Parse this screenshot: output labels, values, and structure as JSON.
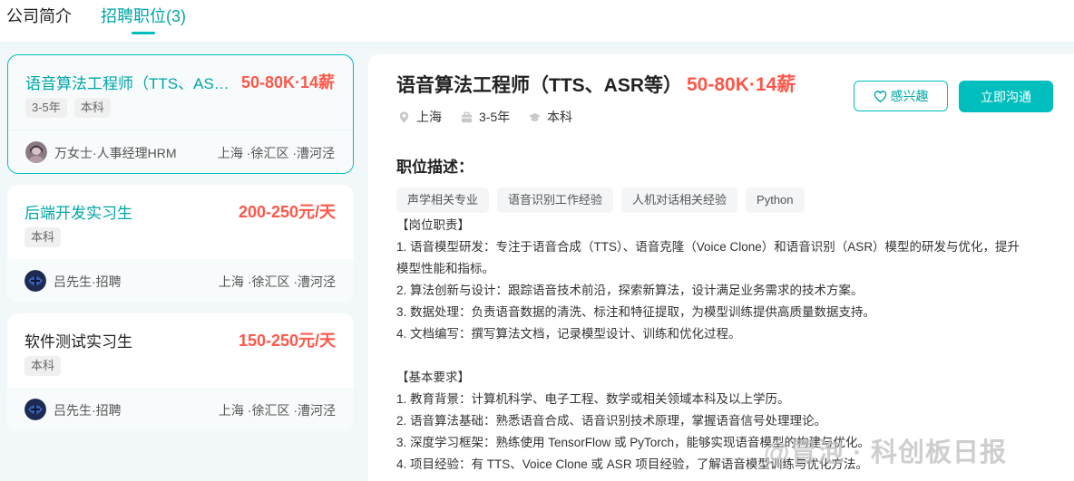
{
  "tabs": [
    {
      "label": "公司简介"
    },
    {
      "label": "招聘职位(3)"
    }
  ],
  "jobs": [
    {
      "title": "语音算法工程师（TTS、ASR等）",
      "salary": "50-80K·14薪",
      "tags": [
        "3-5年",
        "本科"
      ],
      "recruiter": "万女士·人事经理HRM",
      "location": "上海 ·徐汇区 ·漕河泾"
    },
    {
      "title": "后端开发实习生",
      "salary": "200-250元/天",
      "tags": [
        "本科"
      ],
      "recruiter": "吕先生·招聘",
      "location": "上海 ·徐汇区 ·漕河泾"
    },
    {
      "title": "软件测试实习生",
      "salary": "150-250元/天",
      "tags": [
        "本科"
      ],
      "recruiter": "吕先生·招聘",
      "location": "上海 ·徐汇区 ·漕河泾"
    }
  ],
  "detail": {
    "title": "语音算法工程师（TTS、ASR等）",
    "salary": "50-80K·14薪",
    "city": "上海",
    "experience": "3-5年",
    "degree": "本科",
    "interest_label": "感兴趣",
    "chat_label": "立即沟通",
    "section_title": "职位描述：",
    "skills": [
      "声学相关专业",
      "语音识别工作经验",
      "人机对话相关经验",
      "Python"
    ],
    "lines": [
      "【岗位职责】",
      "1. 语音模型研发：专注于语音合成（TTS）、语音克隆（Voice Clone）和语音识别（ASR）模型的研发与优化，提升",
      "模型性能和指标。",
      "2. 算法创新与设计：跟踪语音技术前沿，探索新算法，设计满足业务需求的技术方案。",
      "3. 数据处理：负责语音数据的清洗、标注和特征提取，为模型训练提供高质量数据支持。",
      "4. 文档编写：撰写算法文档，记录模型设计、训练和优化过程。",
      "",
      "【基本要求】",
      "1. 教育背景：计算机科学、电子工程、数学或相关领域本科及以上学历。",
      "2. 语音算法基础：熟悉语音合成、语音识别技术原理，掌握语音信号处理理论。",
      "3. 深度学习框架：熟练使用 TensorFlow 或 PyTorch，能够实现语音模型的构建与优化。",
      "4. 项目经验：有 TTS、Voice Clone 或 ASR 项目经验，了解语音模型训练与优化方法。"
    ]
  },
  "watermark": "@冒泡 · 科创板日报",
  "colors": {
    "accent": "#00bebd",
    "accent_text": "#00a6a7",
    "salary": "#fe574a"
  }
}
